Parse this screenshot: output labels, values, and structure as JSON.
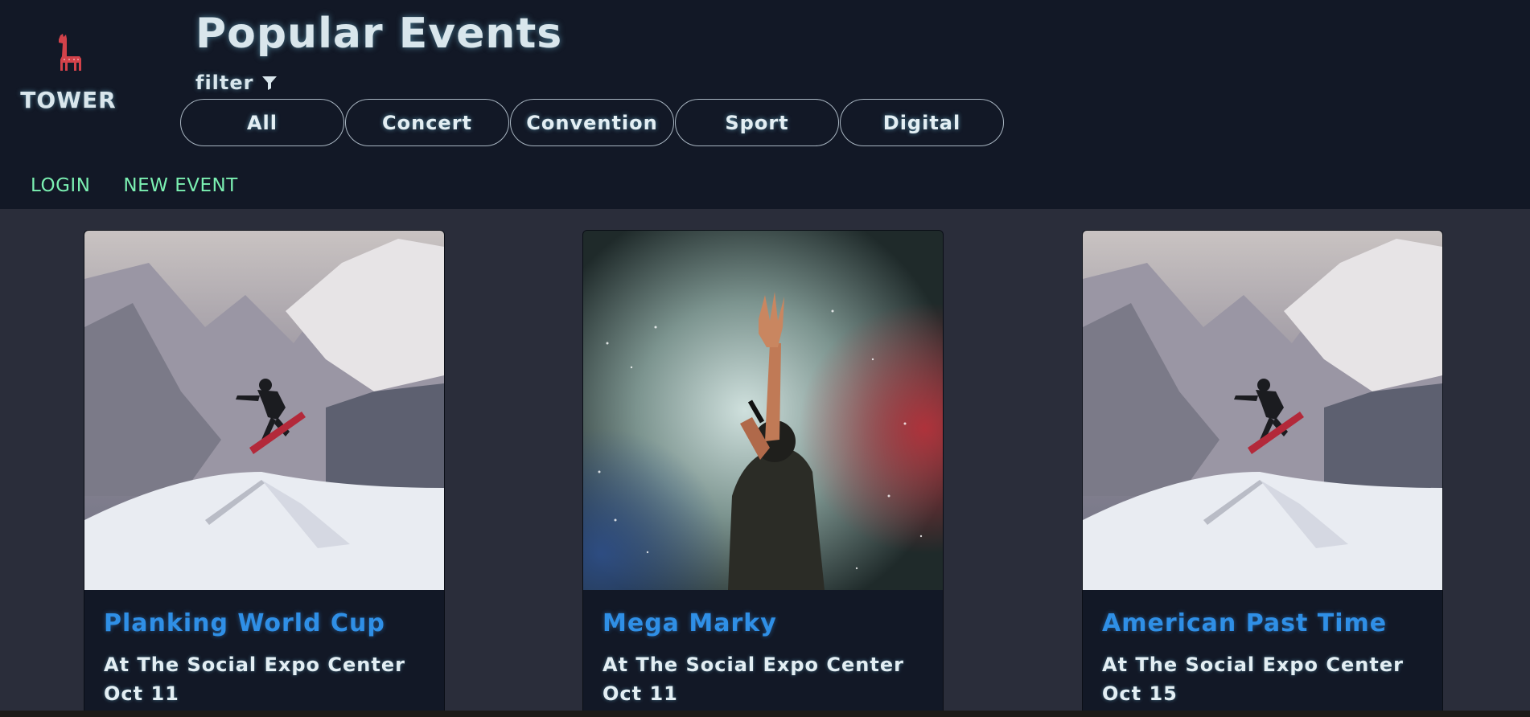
{
  "brand": {
    "name": "TOWER",
    "icon": "llama-icon"
  },
  "header": {
    "title": "Popular Events",
    "filter_label": "filter",
    "filter_icon": "funnel-icon",
    "filters": [
      {
        "label": "All"
      },
      {
        "label": "Concert"
      },
      {
        "label": "Convention"
      },
      {
        "label": "Sport"
      },
      {
        "label": "Digital"
      }
    ]
  },
  "nav": {
    "login": "LOGIN",
    "new_event": "NEW EVENT"
  },
  "events": [
    {
      "title": "Planking World Cup",
      "location": "At The Social Expo Center",
      "date": "Oct 11",
      "image": "snowboarder-photo"
    },
    {
      "title": "Mega Marky",
      "location": "At The Social Expo Center",
      "date": "Oct 11",
      "image": "concert-singer-photo"
    },
    {
      "title": "American Past Time",
      "location": "At The Social Expo Center",
      "date": "Oct 15",
      "image": "snowboarder-photo"
    }
  ],
  "colors": {
    "header_bg": "#121826",
    "page_bg": "#2a2d3a",
    "nav_link": "#7bf0b2",
    "card_title": "#2f8fe6",
    "logo_icon": "#d2424a"
  }
}
